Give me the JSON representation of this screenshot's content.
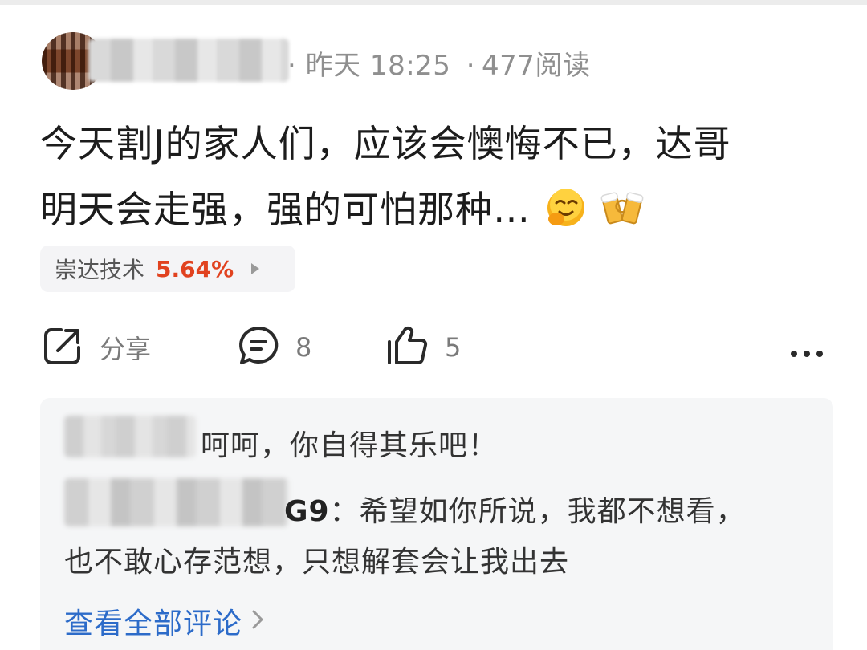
{
  "post": {
    "meta_time": "昨天 18:25",
    "meta_sep": "·",
    "meta_reads": "477阅读",
    "name_tail": "l",
    "content_line1": "今天割J的家人们，应该会懊悔不已，达哥",
    "content_line2": "明天会走强，强的可怕那种…",
    "emojis": [
      "smirk-face",
      "cheers-beer"
    ]
  },
  "stock": {
    "name": "崇达技术",
    "change": "5.64%",
    "change_color": "#e1421f"
  },
  "actions": {
    "share_label": "分享",
    "comment_count": "8",
    "like_count": "5"
  },
  "comments": {
    "c1_text": "呵呵，你自得其乐吧！",
    "c2_name_tail": "G9",
    "c2_text": "：希望如你所说，我都不想看，",
    "c2_text_cont": "也不敢心存范想，只想解套会让我出去",
    "view_all": "查看全部评论"
  }
}
